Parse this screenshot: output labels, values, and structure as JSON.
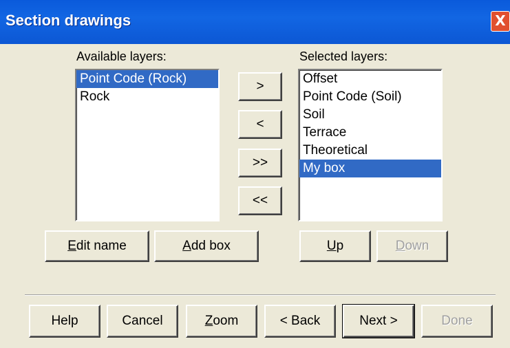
{
  "window": {
    "title": "Section drawings",
    "close_label": "X"
  },
  "available": {
    "label": "Available layers:",
    "items": [
      {
        "label": "Point Code (Rock)",
        "selected": true
      },
      {
        "label": "Rock",
        "selected": false
      }
    ]
  },
  "selected": {
    "label": "Selected layers:",
    "items": [
      {
        "label": "Offset",
        "selected": false
      },
      {
        "label": "Point Code (Soil)",
        "selected": false
      },
      {
        "label": "Soil",
        "selected": false
      },
      {
        "label": "Terrace",
        "selected": false
      },
      {
        "label": "Theoretical",
        "selected": false
      },
      {
        "label": "My box",
        "selected": true
      }
    ]
  },
  "transfer": {
    "add_one": ">",
    "remove_one": "<",
    "add_all": ">>",
    "remove_all": "<<"
  },
  "actions": {
    "edit_name": {
      "mnemonic": "E",
      "rest": "dit name"
    },
    "add_box": {
      "mnemonic": "A",
      "rest": "dd box"
    },
    "up": {
      "mnemonic": "U",
      "rest": "p"
    },
    "down": {
      "mnemonic": "D",
      "rest": "own",
      "enabled": false
    }
  },
  "footer": {
    "help": "Help",
    "cancel": "Cancel",
    "zoom": {
      "mnemonic": "Z",
      "rest": "oom"
    },
    "back": "< Back",
    "next": "Next >",
    "done": {
      "label": "Done",
      "enabled": false
    }
  },
  "colors": {
    "title_bar": "#0A5ADB",
    "dialog_background": "#ECE9D8",
    "selection": "#316AC5",
    "close_button": "#E1502F"
  }
}
